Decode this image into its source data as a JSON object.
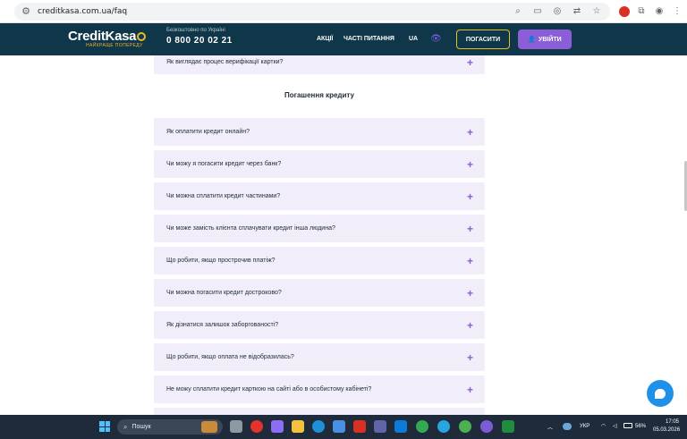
{
  "browser": {
    "url": "creditkasa.com.ua/faq"
  },
  "header": {
    "logo_credit": "Credit",
    "logo_kasa": "Kasa",
    "logo_tagline": "НАЙКРАЩЕ ПОПЕРЕДУ",
    "phone_caption": "Безкоштовно по Україні",
    "phone_number": "0 800 20 02 21",
    "menu": [
      "АКЦІЇ",
      "ЧАСТІ ПИТАННЯ",
      "UA"
    ],
    "pay_button": "ПОГАСИТИ",
    "login_button": "УВІЙТИ"
  },
  "faq": {
    "prev_item": "Як виглядає процес верифікації картки?",
    "section_title": "Погашення кредиту",
    "items": [
      "Як оплатити кредит онлайн?",
      "Чи можу я погасити кредит через банк?",
      "Чи можна сплатити кредит частинами?",
      "Чи може замість клієнта сплачувати кредит інша людина?",
      "Що робити, якщо прострочив платіж?",
      "Чи можна погасити кредит достроково?",
      "Як дізнатися залишок заборгованості?",
      "Що робити, якщо оплата не відобразилась?",
      "Не можу сплатити кредит карткою на сайті або в особистому кабінеті?"
    ]
  },
  "taskbar": {
    "search_label": "Пошук",
    "lang": "УКР",
    "battery": "56%",
    "time": "17:05",
    "date": "05.03.2026"
  },
  "colors": {
    "header_bg": "#0f3649",
    "accent_yellow": "#e8c01d",
    "accent_purple": "#8b5ed8",
    "faq_bg": "#f1eefa"
  }
}
